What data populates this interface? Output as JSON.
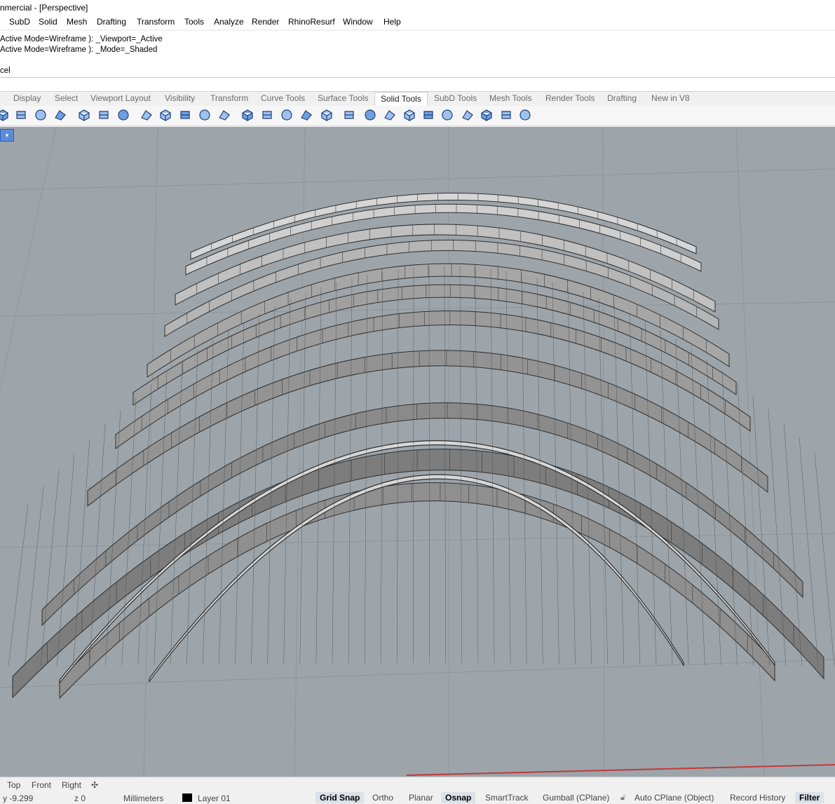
{
  "window": {
    "title": "nmercial - [Perspective]"
  },
  "menu": [
    "SubD",
    "Solid",
    "Mesh",
    "Drafting",
    "Transform",
    "Tools",
    "Analyze",
    "Render",
    "RhinoResurf",
    "Window",
    "Help"
  ],
  "command_history": [
    "Active  Mode=Wireframe ): _Viewport=_Active",
    "Active  Mode=Wireframe ): _Mode=_Shaded",
    "",
    "cel"
  ],
  "command_prompt": {
    "value": ""
  },
  "toolbar_tabs": [
    {
      "label": "Display",
      "active": false
    },
    {
      "label": "Select",
      "active": false
    },
    {
      "label": "Viewport Layout",
      "active": false
    },
    {
      "label": "Visibility",
      "active": false
    },
    {
      "label": "Transform",
      "active": false
    },
    {
      "label": "Curve Tools",
      "active": false
    },
    {
      "label": "Surface Tools",
      "active": false
    },
    {
      "label": "Solid Tools",
      "active": true
    },
    {
      "label": "SubD Tools",
      "active": false
    },
    {
      "label": "Mesh Tools",
      "active": false
    },
    {
      "label": "Render Tools",
      "active": false
    },
    {
      "label": "Drafting",
      "active": false
    },
    {
      "label": "New in V8",
      "active": false
    }
  ],
  "tools": [
    "extrude-surface",
    "offset-surface",
    "solid-box",
    "solid-network",
    "boolean-union",
    "boolean-difference",
    "boolean-intersection",
    "fillet-edge",
    "chamfer-edge",
    "blend-edge",
    "variable-fillet",
    "move-face",
    "extract-surface",
    "split-solid",
    "wirecut",
    "cap-holes",
    "shell",
    "create-solid",
    "pipe",
    "taper",
    "ribbon",
    "draft",
    "slab",
    "mesh-grid",
    "mesh-grid-2",
    "delete-edge",
    "bucket",
    "split-tool"
  ],
  "colors": {
    "viewport_bg": "#9da5ab",
    "grid_line": "#8e969c",
    "object_dark": "#2d2d2d",
    "object_light": "#d7d7d7",
    "x_axis": "#c0393b",
    "active_pane": "#dbe1e8",
    "viewport_title_bg": "#5b8bd9"
  },
  "viewport": {
    "name": "Perspective",
    "display_mode": "Shaded"
  },
  "view_tabs": [
    "Top",
    "Front",
    "Right"
  ],
  "status": {
    "coordinate_y": "y -9.299",
    "coordinate_z": "z 0",
    "units": "Millimeters",
    "layer": "Layer 01",
    "panes": [
      {
        "label": "Grid Snap",
        "on": true
      },
      {
        "label": "Ortho",
        "on": false
      },
      {
        "label": "Planar",
        "on": false
      },
      {
        "label": "Osnap",
        "on": true
      },
      {
        "label": "SmartTrack",
        "on": false
      },
      {
        "label": "Gumball (CPlane)",
        "on": false
      },
      {
        "label": "Auto CPlane (Object)",
        "on": false
      },
      {
        "label": "Record History",
        "on": false
      },
      {
        "label": "Filter",
        "on": true
      }
    ]
  }
}
